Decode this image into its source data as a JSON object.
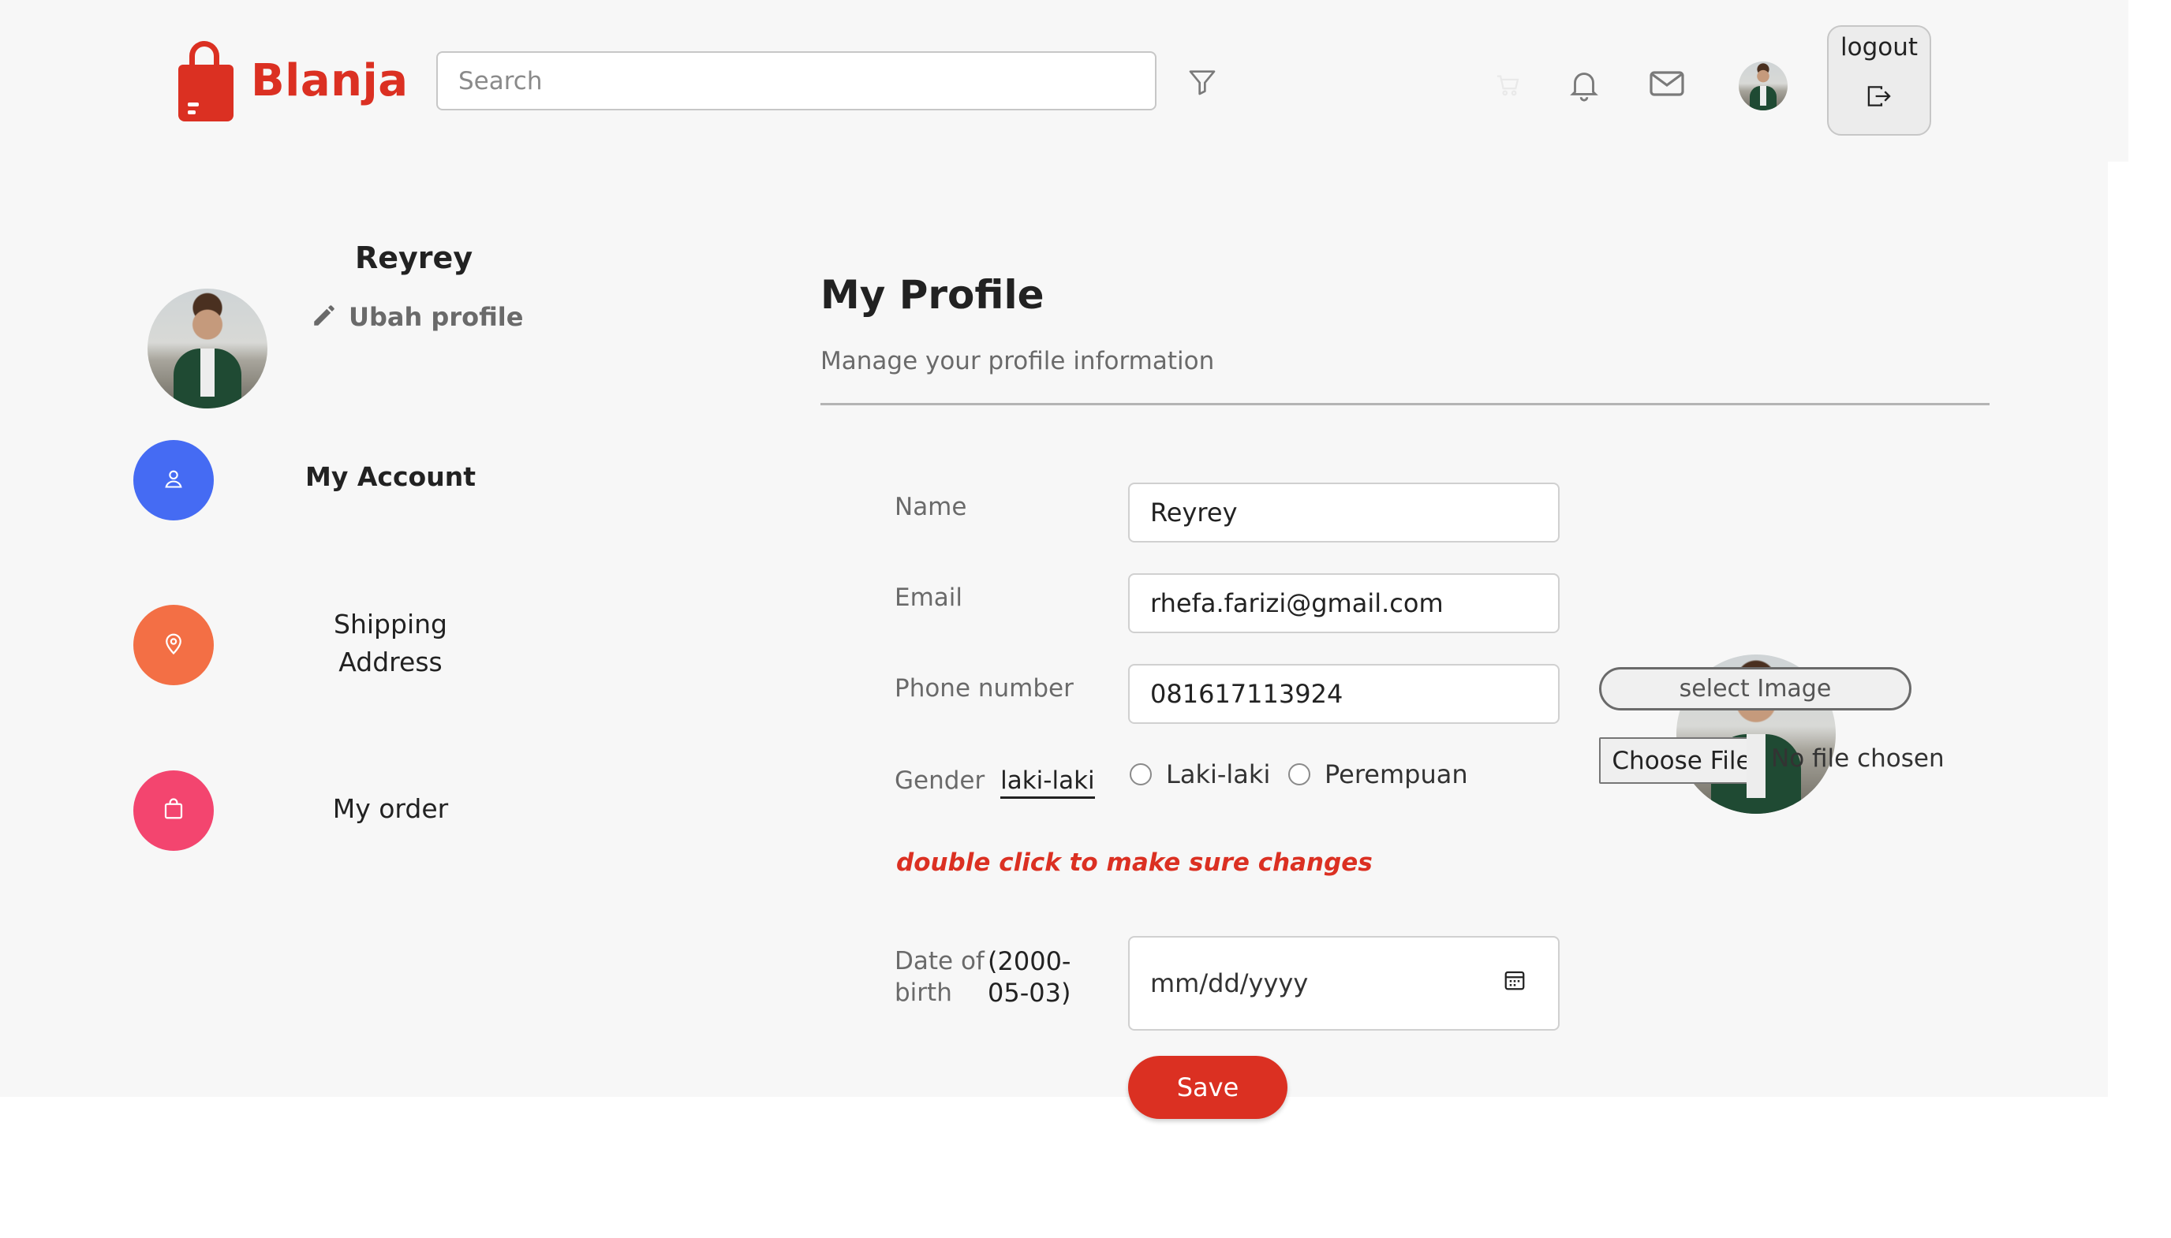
{
  "header": {
    "brand": "Blanja",
    "search_placeholder": "Search",
    "logout_label": "logout"
  },
  "sidebar": {
    "user_name": "Reyrey",
    "edit_label": "Ubah profile",
    "items": [
      {
        "label": "My Account",
        "color": "#456bf3"
      },
      {
        "label": "Shipping\nAddress",
        "color": "#f36f45"
      },
      {
        "label": "My order",
        "color": "#f3456f"
      }
    ]
  },
  "main": {
    "title": "My Profile",
    "subtitle": "Manage your profile information",
    "form": {
      "name_label": "Name",
      "name_value": "Reyrey",
      "email_label": "Email",
      "email_value": "rhefa.farizi@gmail.com",
      "phone_label": "Phone number",
      "phone_value": "081617113924",
      "gender_label": "Gender",
      "gender_value": "laki-laki",
      "gender_options": [
        "Laki-laki",
        "Perempuan"
      ],
      "notice": "double click to make sure changes",
      "dob_label_line1": "Date of",
      "dob_label_line2": "birth",
      "dob_value_line1": "(2000-",
      "dob_value_line2": "05-03)",
      "dob_placeholder": "mm/dd/yyyy",
      "save_label": "Save"
    },
    "photo": {
      "select_label": "select Image",
      "choose_file_label": "Choose File",
      "no_file_label": "No file chosen"
    }
  },
  "colors": {
    "brand": "#db3022",
    "background": "#f7f7f7"
  }
}
